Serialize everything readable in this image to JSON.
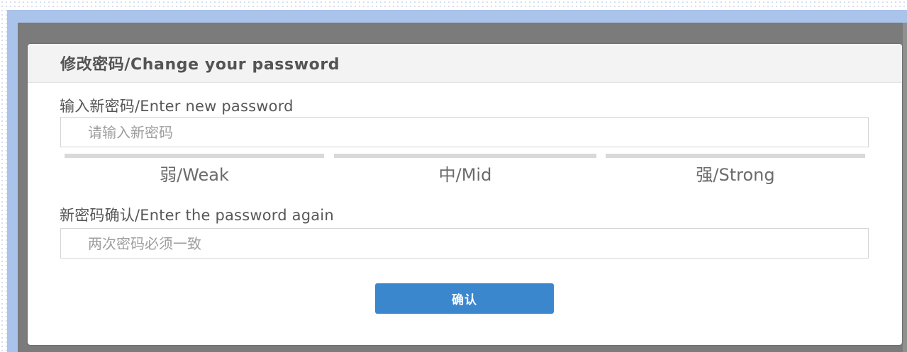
{
  "dialog": {
    "title": "修改密码/Change your password",
    "new_password": {
      "label": "输入新密码/Enter new password",
      "placeholder": "请输入新密码",
      "value": ""
    },
    "strength": {
      "levels": [
        "弱/Weak",
        "中/Mid",
        "强/Strong"
      ]
    },
    "confirm_password": {
      "label": "新密码确认/Enter the password again",
      "placeholder": "两次密码必须一致",
      "value": ""
    },
    "confirm_button_label": "确认"
  },
  "colors": {
    "overlay": "#7b7b7b",
    "page_band": "#a9c3ea",
    "header_bg": "#f3f3f3",
    "button_primary": "#3b87ce",
    "strength_bar": "#d9d9d9"
  }
}
